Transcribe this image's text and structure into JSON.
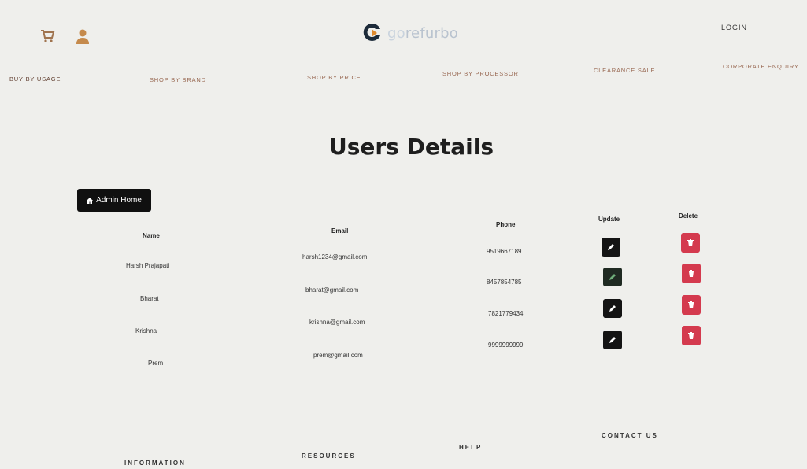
{
  "header": {
    "brand": {
      "prefix": "go",
      "suffix": "refurbo"
    },
    "login_label": "LOGIN"
  },
  "nav": {
    "items": [
      {
        "label": "BUY BY USAGE"
      },
      {
        "label": "SHOP BY BRAND"
      },
      {
        "label": "SHOP BY PRICE"
      },
      {
        "label": "SHOP BY PROCESSOR"
      },
      {
        "label": "CLEARANCE SALE"
      },
      {
        "label": "CORPORATE ENQUIRY"
      }
    ]
  },
  "main": {
    "title": "Users Details",
    "admin_button_label": "Admin Home",
    "columns": {
      "name": "Name",
      "email": "Email",
      "phone": "Phone",
      "update": "Update",
      "delete": "Delete"
    },
    "users": [
      {
        "name": "Harsh Prajapati",
        "email": "harsh1234@gmail.com",
        "phone": "9519667189"
      },
      {
        "name": "Bharat",
        "email": "bharat@gmail.com",
        "phone": "8457854785"
      },
      {
        "name": "Krishna",
        "email": "krishna@gmail.com",
        "phone": "7821779434"
      },
      {
        "name": "Prem",
        "email": "prem@gmail.com",
        "phone": "9999999999"
      }
    ]
  },
  "footer": {
    "information": "INFORMATION",
    "resources": "RESOURCES",
    "help": "HELP",
    "contact": "CONTACT US"
  },
  "colors": {
    "delete": "#d43a4e",
    "update": "#141414",
    "nav_text": "#9a6b55"
  }
}
